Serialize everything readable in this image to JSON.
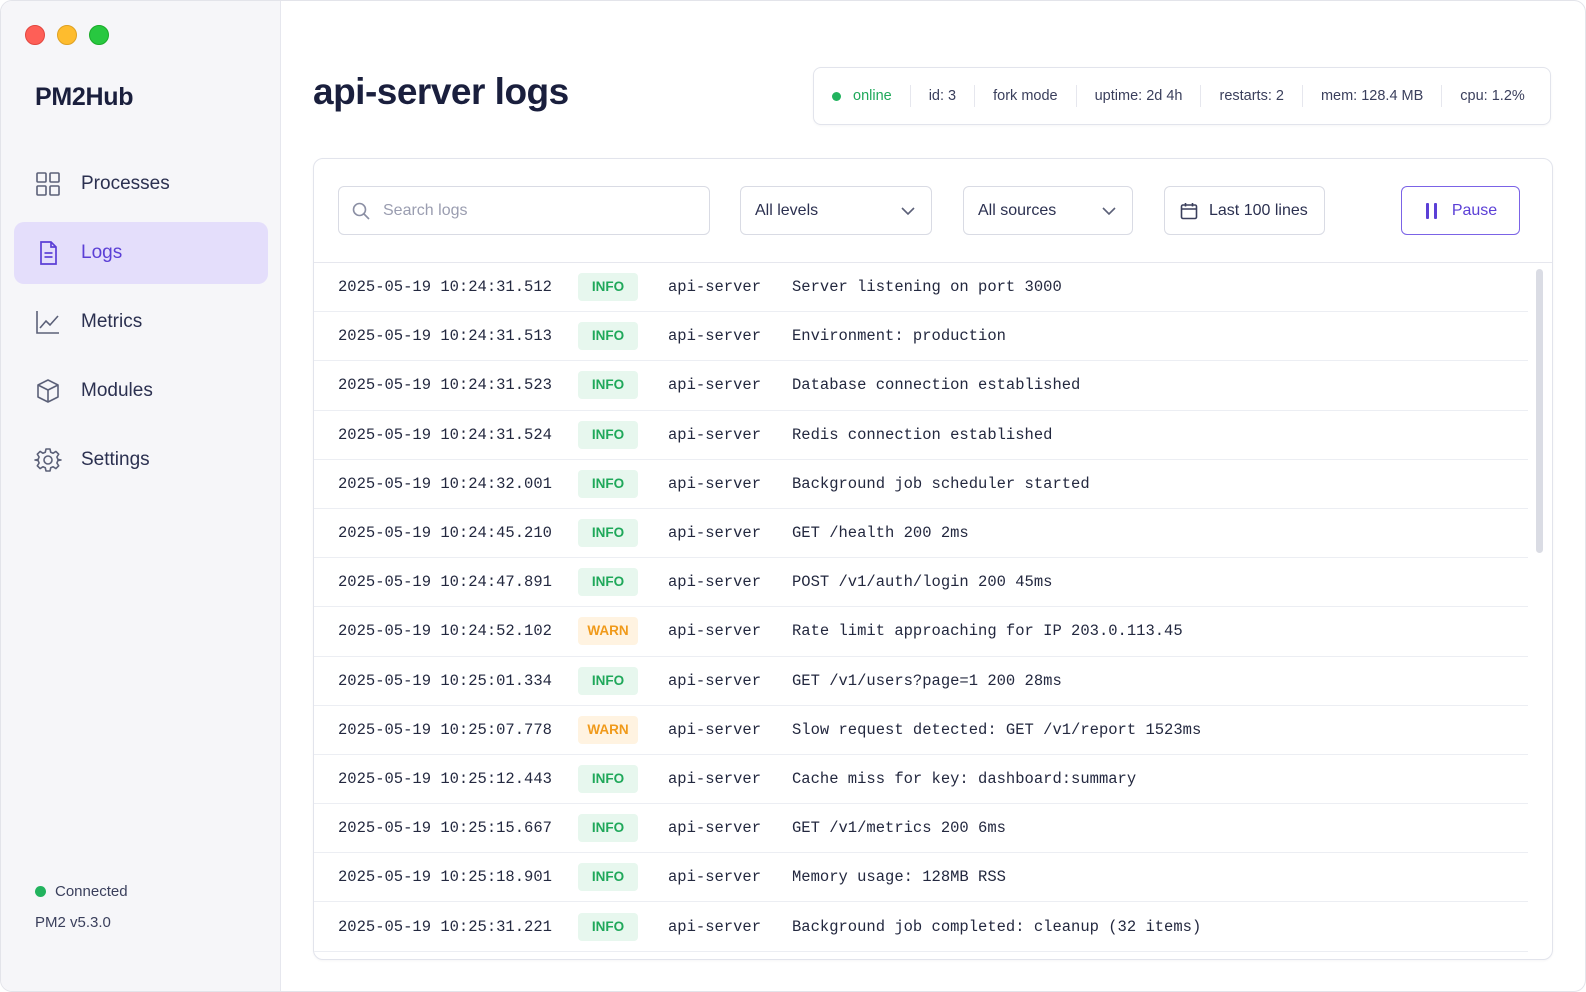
{
  "app": {
    "name": "PM2Hub"
  },
  "sidebar": {
    "items": [
      {
        "label": "Processes",
        "icon": "grid-icon",
        "active": false
      },
      {
        "label": "Logs",
        "icon": "document-icon",
        "active": true
      },
      {
        "label": "Metrics",
        "icon": "line-chart-icon",
        "active": false
      },
      {
        "label": "Modules",
        "icon": "cube-icon",
        "active": false
      },
      {
        "label": "Settings",
        "icon": "gear-icon",
        "active": false
      }
    ],
    "connection": "Connected",
    "version": "PM2 v5.3.0"
  },
  "header": {
    "title": "api-server logs"
  },
  "status": {
    "state": "online",
    "id": "id: 3",
    "mode": "fork mode",
    "uptime": "uptime: 2d 4h",
    "restarts": "restarts: 2",
    "mem": "mem: 128.4 MB",
    "cpu": "cpu: 1.2%"
  },
  "toolbar": {
    "search_placeholder": "Search logs",
    "levels": "All levels",
    "sources": "All sources",
    "lines": "Last 100 lines",
    "pause": "Pause"
  },
  "colors": {
    "accent": "#5b3fd6",
    "active_nav_bg": "#e4defb",
    "online": "#1fa85a",
    "info": "#1fa85a",
    "warn": "#f09a1a"
  },
  "logs": [
    {
      "ts": "2025-05-19 10:24:31.512",
      "level": "INFO",
      "source": "api-server",
      "message": "Server listening on port 3000"
    },
    {
      "ts": "2025-05-19 10:24:31.513",
      "level": "INFO",
      "source": "api-server",
      "message": "Environment: production"
    },
    {
      "ts": "2025-05-19 10:24:31.523",
      "level": "INFO",
      "source": "api-server",
      "message": "Database connection established"
    },
    {
      "ts": "2025-05-19 10:24:31.524",
      "level": "INFO",
      "source": "api-server",
      "message": "Redis connection established"
    },
    {
      "ts": "2025-05-19 10:24:32.001",
      "level": "INFO",
      "source": "api-server",
      "message": "Background job scheduler started"
    },
    {
      "ts": "2025-05-19 10:24:45.210",
      "level": "INFO",
      "source": "api-server",
      "message": "GET /health 200 2ms"
    },
    {
      "ts": "2025-05-19 10:24:47.891",
      "level": "INFO",
      "source": "api-server",
      "message": "POST /v1/auth/login 200 45ms"
    },
    {
      "ts": "2025-05-19 10:24:52.102",
      "level": "WARN",
      "source": "api-server",
      "message": "Rate limit approaching for IP 203.0.113.45"
    },
    {
      "ts": "2025-05-19 10:25:01.334",
      "level": "INFO",
      "source": "api-server",
      "message": "GET /v1/users?page=1 200 28ms"
    },
    {
      "ts": "2025-05-19 10:25:07.778",
      "level": "WARN",
      "source": "api-server",
      "message": "Slow request detected: GET /v1/report 1523ms"
    },
    {
      "ts": "2025-05-19 10:25:12.443",
      "level": "INFO",
      "source": "api-server",
      "message": "Cache miss for key: dashboard:summary"
    },
    {
      "ts": "2025-05-19 10:25:15.667",
      "level": "INFO",
      "source": "api-server",
      "message": "GET /v1/metrics 200 6ms"
    },
    {
      "ts": "2025-05-19 10:25:18.901",
      "level": "INFO",
      "source": "api-server",
      "message": "Memory usage: 128MB RSS"
    },
    {
      "ts": "2025-05-19 10:25:31.221",
      "level": "INFO",
      "source": "api-server",
      "message": "Background job completed: cleanup (32 items)"
    }
  ]
}
